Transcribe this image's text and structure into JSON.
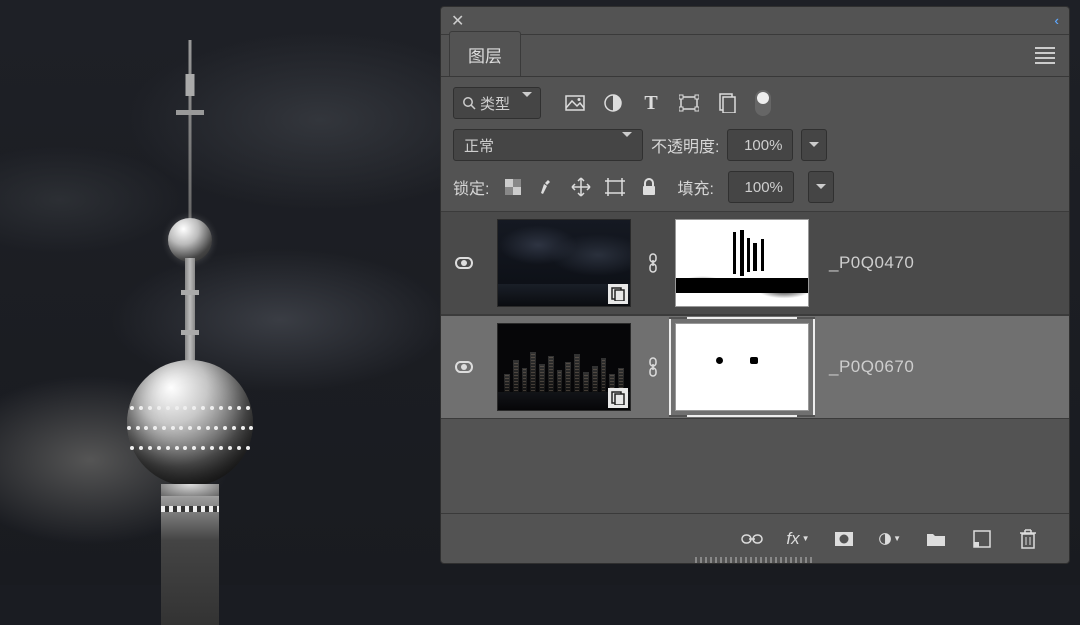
{
  "panel": {
    "tab_label": "图层",
    "filter_label": "类型",
    "blend_mode": "正常",
    "opacity_label": "不透明度:",
    "opacity_value": "100%",
    "lock_label": "锁定:",
    "fill_label": "填充:",
    "fill_value": "100%"
  },
  "filter_icons": {
    "image": "image-filter-icon",
    "adjust": "adjustment-filter-icon",
    "type": "type-filter-icon",
    "shape": "shape-filter-icon",
    "smart": "smart-filter-icon"
  },
  "layers": [
    {
      "name": "_P0Q0470",
      "visible": true,
      "selected": false
    },
    {
      "name": "_P0Q0670",
      "visible": true,
      "selected": true
    }
  ],
  "bottom_icons": {
    "link": "link-icon",
    "fx": "fx",
    "mask": "mask-icon",
    "adjust": "adjustment-icon",
    "group": "group-icon",
    "new": "new-layer-icon",
    "trash": "trash-icon"
  }
}
